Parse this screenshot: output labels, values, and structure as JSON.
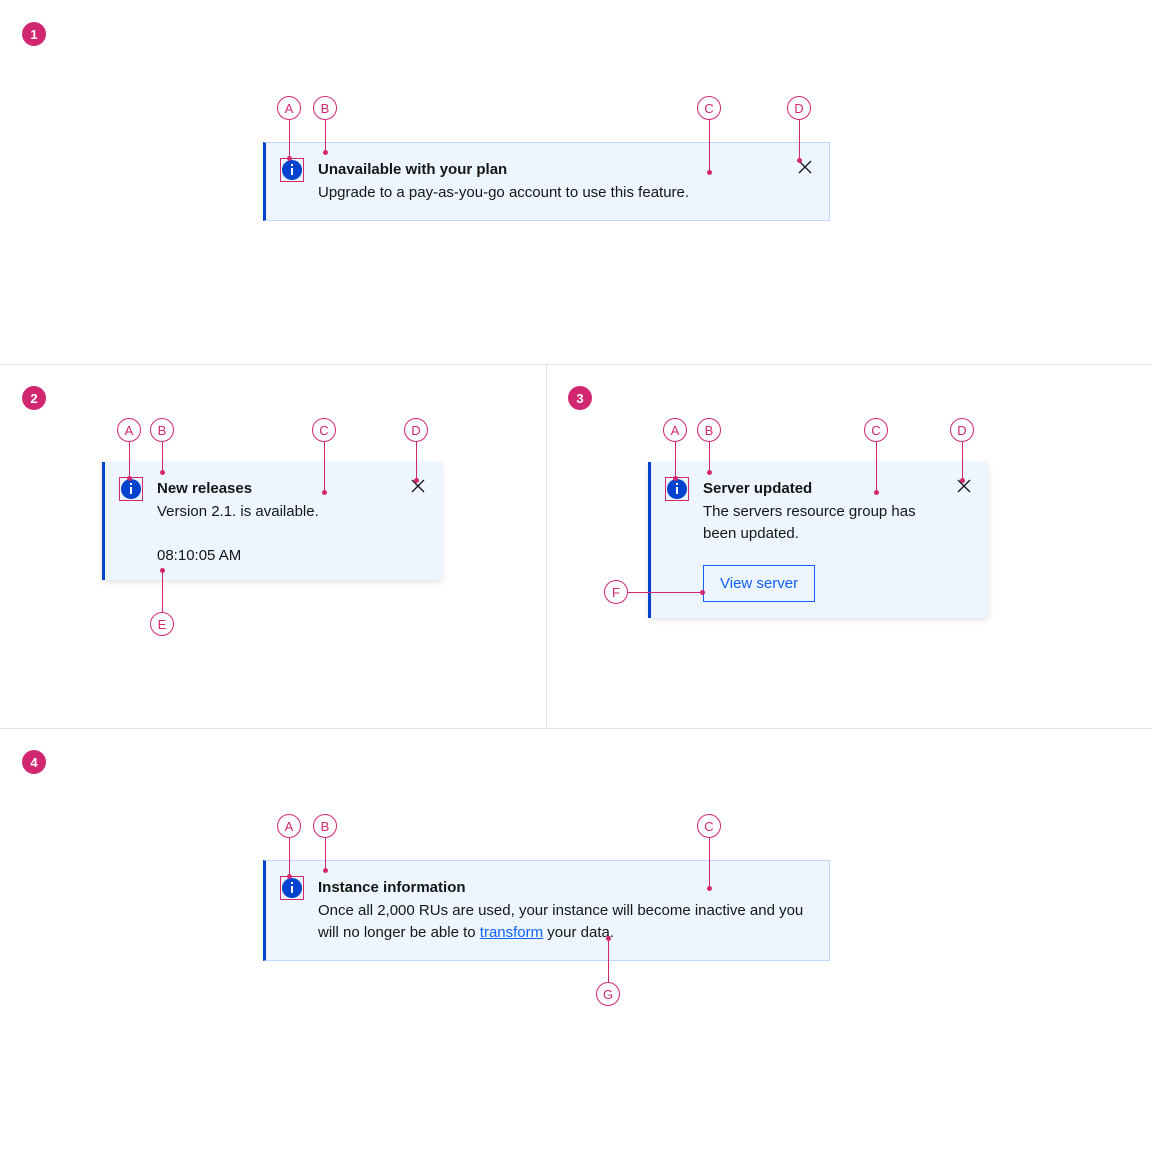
{
  "badges": {
    "s1": "1",
    "s2": "2",
    "s3": "3",
    "s4": "4"
  },
  "annotations": {
    "A": "A",
    "B": "B",
    "C": "C",
    "D": "D",
    "E": "E",
    "F": "F",
    "G": "G"
  },
  "notif1": {
    "title": "Unavailable with your plan",
    "message": "Upgrade to a pay-as-you-go account to use this feature."
  },
  "notif2": {
    "title": "New releases",
    "message": "Version 2.1. is available.",
    "timestamp": "08:10:05 AM"
  },
  "notif3": {
    "title": "Server updated",
    "message": "The servers resource group has been updated.",
    "action": "View server"
  },
  "notif4": {
    "title": "Instance information",
    "message_pre": "Once all 2,000 RUs are used, your instance will become inactive and you will no longer be able to ",
    "link": "transform",
    "message_post": " your data."
  }
}
